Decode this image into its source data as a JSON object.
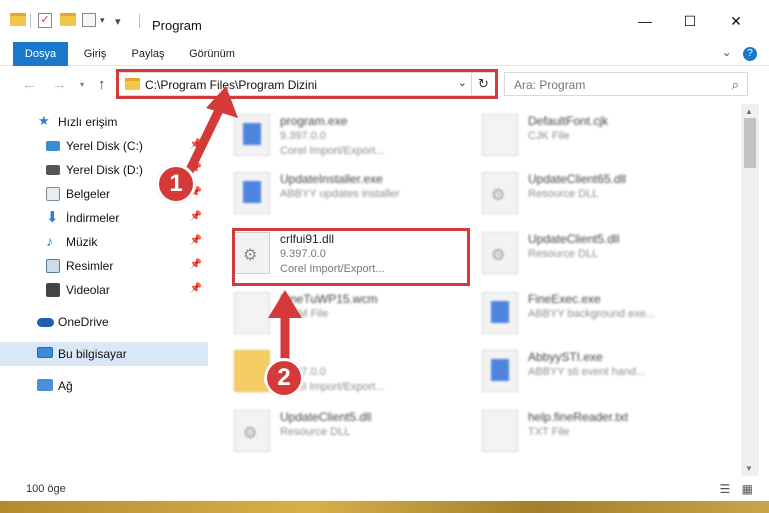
{
  "window": {
    "title": "Program",
    "controls": {
      "minimize": "—",
      "maximize": "☐",
      "close": "✕"
    }
  },
  "ribbon": {
    "tabs": [
      {
        "label": "Dosya",
        "active": true
      },
      {
        "label": "Giriş"
      },
      {
        "label": "Paylaş"
      },
      {
        "label": "Görünüm"
      }
    ]
  },
  "navigation": {
    "address": "C:\\Program Files\\Program Dizini",
    "search_placeholder": "Ara: Program"
  },
  "sidebar": {
    "quick_access_label": "Hızlı erişim",
    "items": [
      {
        "label": "Yerel Disk (C:)",
        "icon": "drive-icon",
        "color": "#3a8bd8"
      },
      {
        "label": "Yerel Disk (D:)",
        "icon": "drive-icon",
        "color": "#555555"
      },
      {
        "label": "Belgeler",
        "icon": "documents-icon",
        "color": "#7a8a99"
      },
      {
        "label": "İndirmeler",
        "icon": "downloads-icon",
        "color": "#2f7bd8"
      },
      {
        "label": "Müzik",
        "icon": "music-icon",
        "color": "#2f7bd8"
      },
      {
        "label": "Resimler",
        "icon": "pictures-icon",
        "color": "#5a7a9a"
      },
      {
        "label": "Videolar",
        "icon": "videos-icon",
        "color": "#444444"
      }
    ],
    "onedrive": "OneDrive",
    "this_pc": "Bu bilgisayar",
    "network": "Ağ"
  },
  "files": {
    "col1": [
      {
        "name": "program.exe",
        "line1": "9.397.0.0",
        "line2": "Corel Import/Export...",
        "icon": "app-icon"
      },
      {
        "name": "UpdateInstaller.exe",
        "line1": "ABBYY updates installer",
        "line2": "",
        "icon": "app-icon"
      },
      {
        "name": "crlfui91.dll",
        "line1": "9.397.0.0",
        "line2": "Corel Import/Export...",
        "icon": "gear-icon",
        "highlighted": true
      },
      {
        "name": "FineTuWP15.wcm",
        "line1": "WCM File",
        "line2": "",
        "icon": "file-icon"
      },
      {
        "name": "",
        "line1": "9.397.0.0",
        "line2": "Corel Import/Export...",
        "icon": "folder-icon"
      },
      {
        "name": "UpdateClient5.dll",
        "line1": "Resource DLL",
        "line2": "",
        "icon": "gear-icon"
      }
    ],
    "col2": [
      {
        "name": "DefaultFont.cjk",
        "line1": "CJK File",
        "icon": "file-icon"
      },
      {
        "name": "UpdateClient65.dll",
        "line1": "Resource DLL",
        "icon": "gear-icon"
      },
      {
        "name": "UpdateClient5.dll",
        "line1": "Resource DLL",
        "icon": "gear-icon"
      },
      {
        "name": "FineExec.exe",
        "line1": "ABBYY background exe...",
        "icon": "app-icon"
      },
      {
        "name": "AbbyySTI.exe",
        "line1": "ABBYY sti event hand...",
        "icon": "app-icon"
      },
      {
        "name": "help.fineReader.txt",
        "line1": "TXT File",
        "icon": "file-icon"
      }
    ]
  },
  "status": {
    "count": "100 öge"
  },
  "callouts": {
    "one": "1",
    "two": "2"
  },
  "colors": {
    "accent": "#1979ca",
    "highlight": "#d43a3a",
    "selected": "#d9e7f6"
  }
}
